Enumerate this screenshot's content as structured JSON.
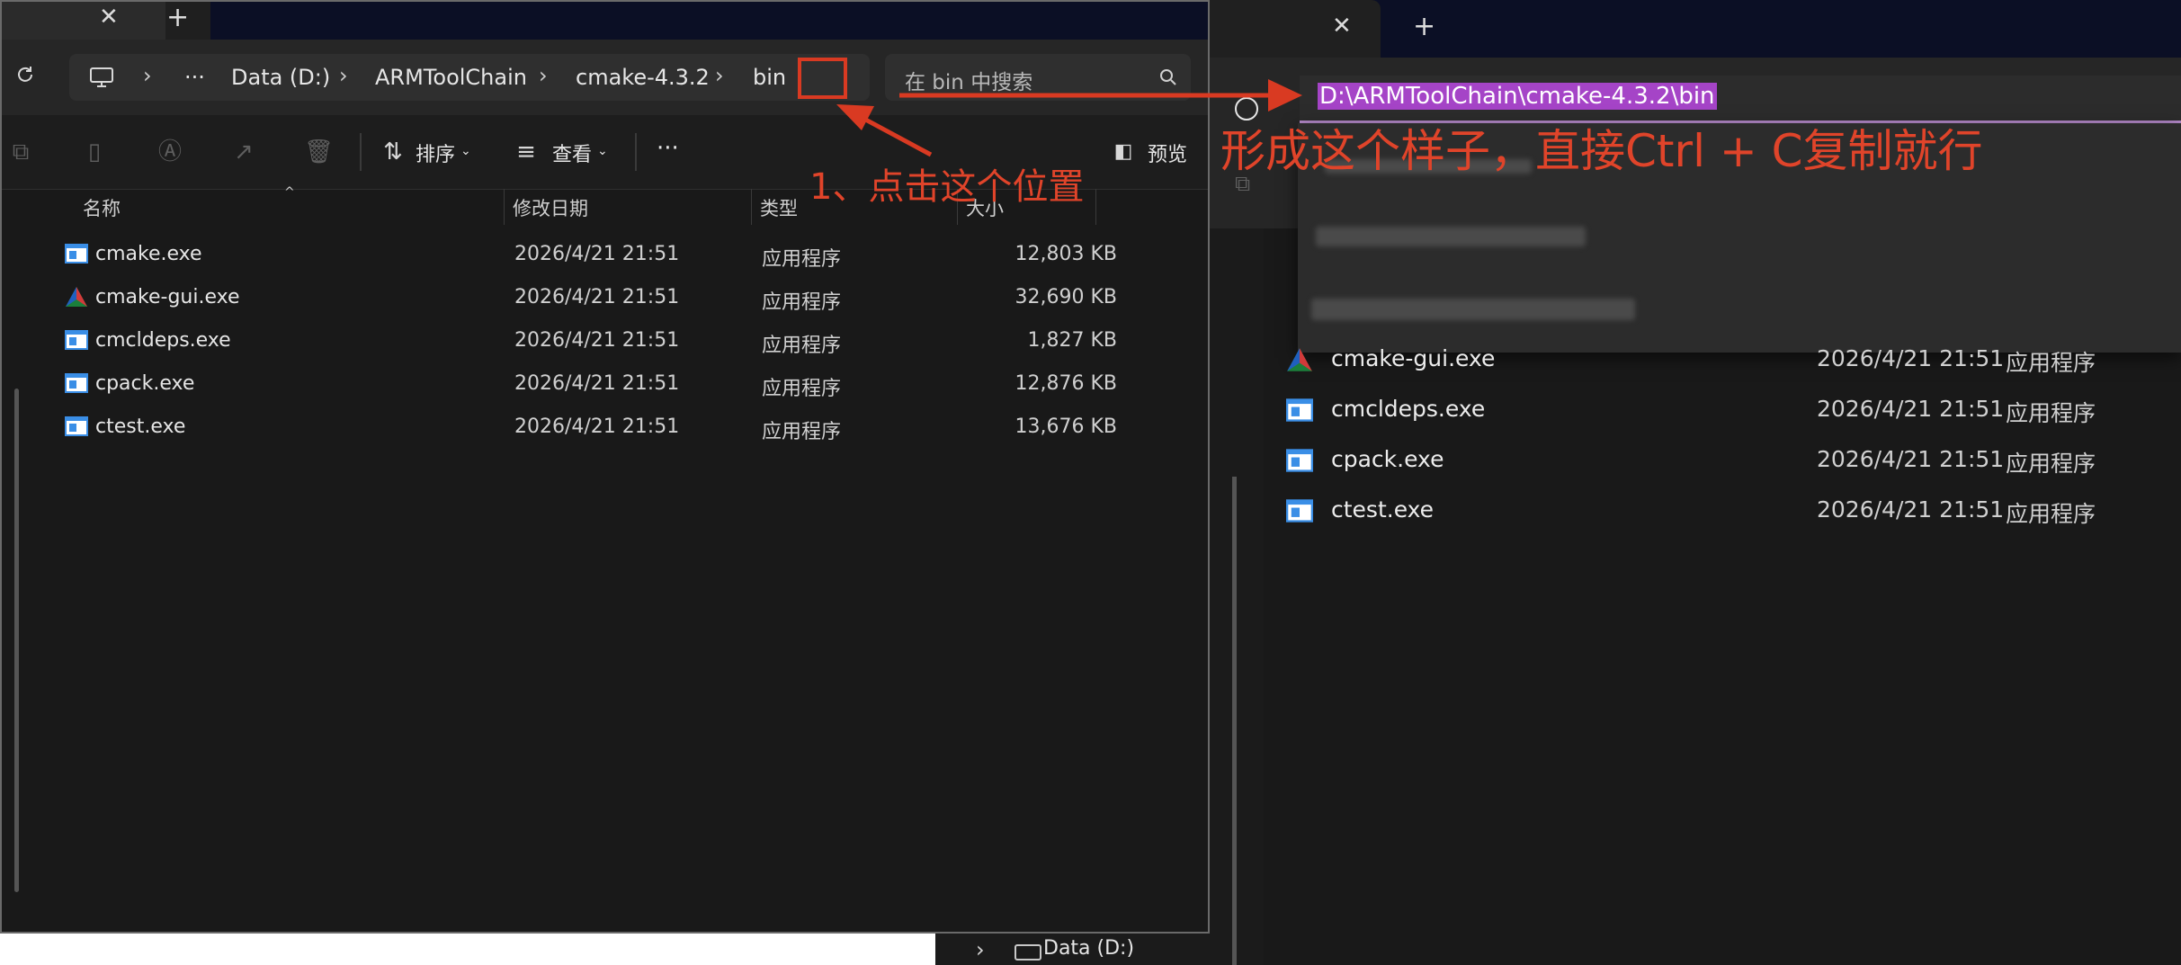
{
  "left_window": {
    "tab_close": "✕",
    "tab_add": "+",
    "breadcrumb": [
      "Data (D:)",
      "ARMToolChain",
      "cmake-4.3.2",
      "bin"
    ],
    "more": "···",
    "search_placeholder": "在 bin 中搜索",
    "toolbar": {
      "sort": "排序",
      "view": "查看",
      "more": "···",
      "preview": "预览"
    },
    "columns": [
      "名称",
      "修改日期",
      "类型",
      "大小"
    ],
    "files": [
      {
        "name": "cmake.exe",
        "date": "2026/4/21 21:51",
        "type": "应用程序",
        "size": "12,803 KB",
        "icon": "exe-icon"
      },
      {
        "name": "cmake-gui.exe",
        "date": "2026/4/21 21:51",
        "type": "应用程序",
        "size": "32,690 KB",
        "icon": "cmake-gui-icon"
      },
      {
        "name": "cmcldeps.exe",
        "date": "2026/4/21 21:51",
        "type": "应用程序",
        "size": "1,827 KB",
        "icon": "exe-icon"
      },
      {
        "name": "cpack.exe",
        "date": "2026/4/21 21:51",
        "type": "应用程序",
        "size": "12,876 KB",
        "icon": "exe-icon"
      },
      {
        "name": "ctest.exe",
        "date": "2026/4/21 21:51",
        "type": "应用程序",
        "size": "13,676 KB",
        "icon": "exe-icon"
      }
    ]
  },
  "nav_drive": "Data (D:)",
  "right_window": {
    "tab_close": "✕",
    "tab_add": "+",
    "address_value": "D:\\ARMToolChain\\cmake-4.3.2\\bin",
    "files": [
      {
        "name": "cmake-gui.exe",
        "date": "2026/4/21 21:51",
        "type": "应用程序"
      },
      {
        "name": "cmcldeps.exe",
        "date": "2026/4/21 21:51",
        "type": "应用程序"
      },
      {
        "name": "cpack.exe",
        "date": "2026/4/21 21:51",
        "type": "应用程序"
      },
      {
        "name": "ctest.exe",
        "date": "2026/4/21 21:51",
        "type": "应用程序"
      }
    ]
  },
  "annotations": {
    "step1": "1、点击这个位置",
    "step2": "形成这个样子，直接Ctrl + C复制就行",
    "color": "#e0442a"
  },
  "colors": {
    "selection": "#a544c7",
    "window_bg": "#191919",
    "accent_red": "#d93a22"
  }
}
